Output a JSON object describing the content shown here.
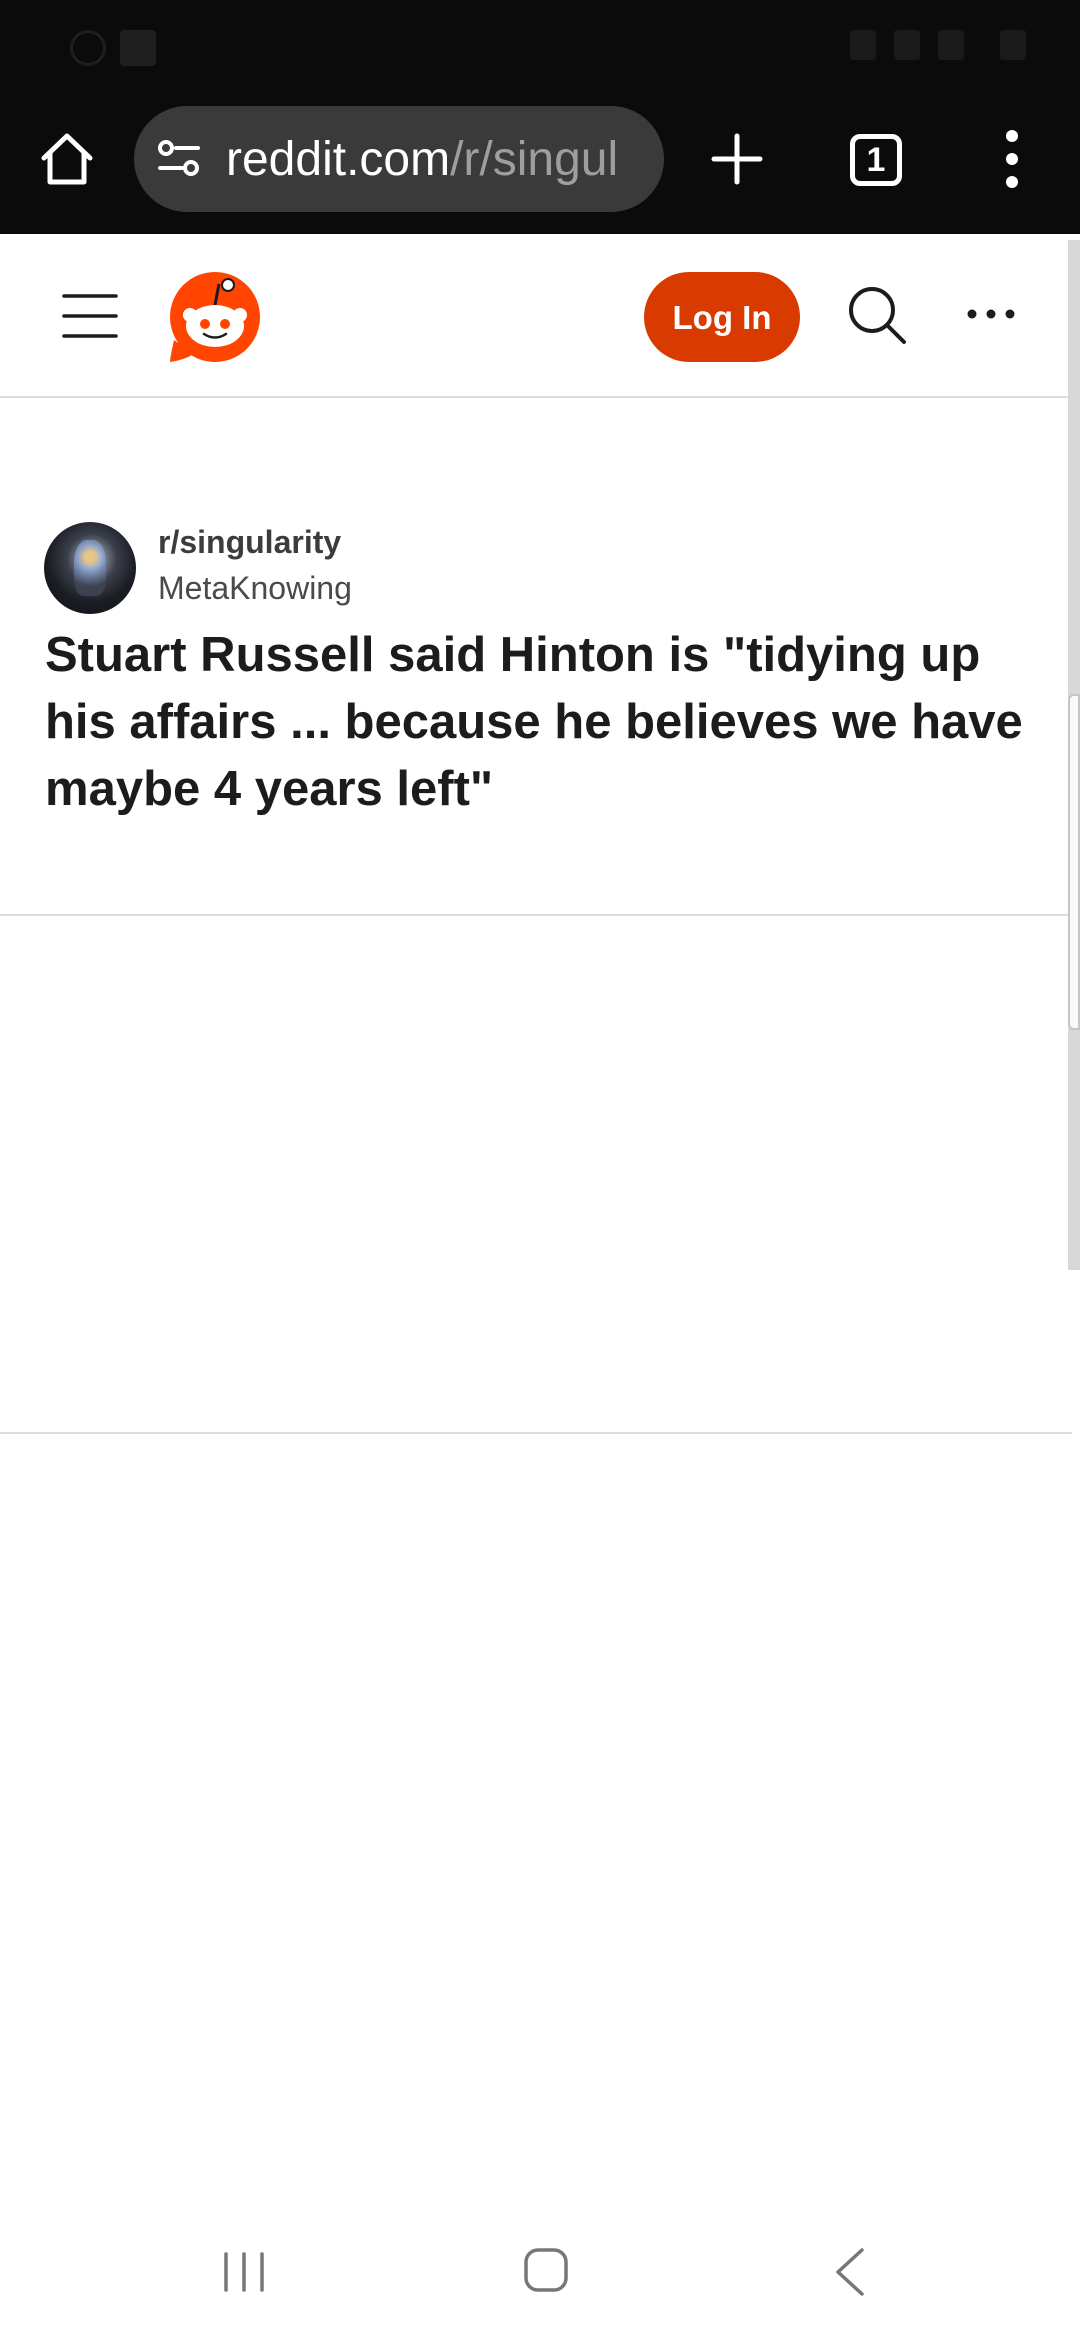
{
  "status_bar": {
    "time": "",
    "battery": ""
  },
  "browser": {
    "url_host": "reddit.com",
    "url_path": "/r/singul",
    "tab_count": "1",
    "load_progress": 0.36
  },
  "header": {
    "login_label": "Log In"
  },
  "post": {
    "subreddit": "r/singularity",
    "author": "MetaKnowing",
    "title": "Stuart Russell said Hinton is \"tidying up his affairs ... because he believes we have maybe 4 years left\""
  },
  "colors": {
    "reddit_orange": "#ff4500",
    "login_button": "#d93a00",
    "browser_chrome": "#0b0b0b",
    "progress": "#6f86d6"
  },
  "icons": {
    "home": "home-icon",
    "site_settings": "tune-icon",
    "new_tab": "plus-icon",
    "menu": "kebab-icon",
    "hamburger": "hamburger-icon",
    "search": "search-icon",
    "more": "ellipsis-icon",
    "nav_recent": "recent-apps-icon",
    "nav_home": "nav-home-icon",
    "nav_back": "back-icon"
  }
}
